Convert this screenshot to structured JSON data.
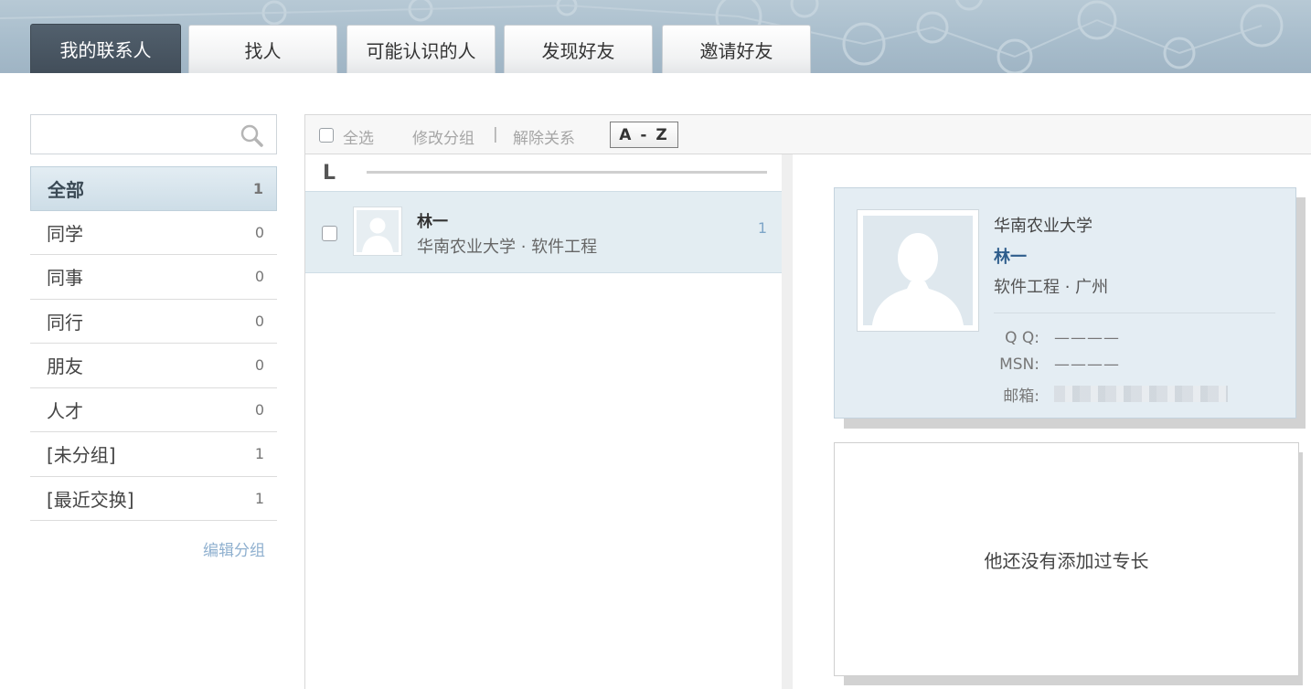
{
  "tabs": [
    {
      "label": "我的联系人",
      "active": true
    },
    {
      "label": "找人"
    },
    {
      "label": "可能认识的人"
    },
    {
      "label": "发现好友"
    },
    {
      "label": "邀请好友"
    }
  ],
  "search": {
    "placeholder": "",
    "icon": "search-icon"
  },
  "groups": [
    {
      "label": "全部",
      "count": "1",
      "active": true
    },
    {
      "label": "同学",
      "count": "0"
    },
    {
      "label": "同事",
      "count": "0"
    },
    {
      "label": "同行",
      "count": "0"
    },
    {
      "label": "朋友",
      "count": "0"
    },
    {
      "label": "人才",
      "count": "0"
    },
    {
      "label": "[未分组]",
      "count": "1"
    },
    {
      "label": "[最近交换]",
      "count": "1"
    }
  ],
  "edit_groups_label": "编辑分组",
  "toolbar": {
    "select_all": "全选",
    "edit_group": "修改分组",
    "separator": "|",
    "remove_relation": "解除关系",
    "sort_button": "A - Z"
  },
  "list": {
    "letter": "L",
    "contacts": [
      {
        "name": "林一",
        "subtitle": "华南农业大学 · 软件工程",
        "count": "1"
      }
    ]
  },
  "detail": {
    "school": "华南农业大学",
    "name": "林一",
    "major_city": "软件工程 · 广州",
    "qq_label": "Q Q:",
    "qq_value": "————",
    "msn_label": "MSN:",
    "msn_value": "————",
    "email_label": "邮箱:"
  },
  "skills_empty_text": "他还没有添加过专长",
  "colors": {
    "active_tab": "#424e5a",
    "name_blue": "#2e5d8c",
    "link_blue": "#8fb0cf"
  }
}
